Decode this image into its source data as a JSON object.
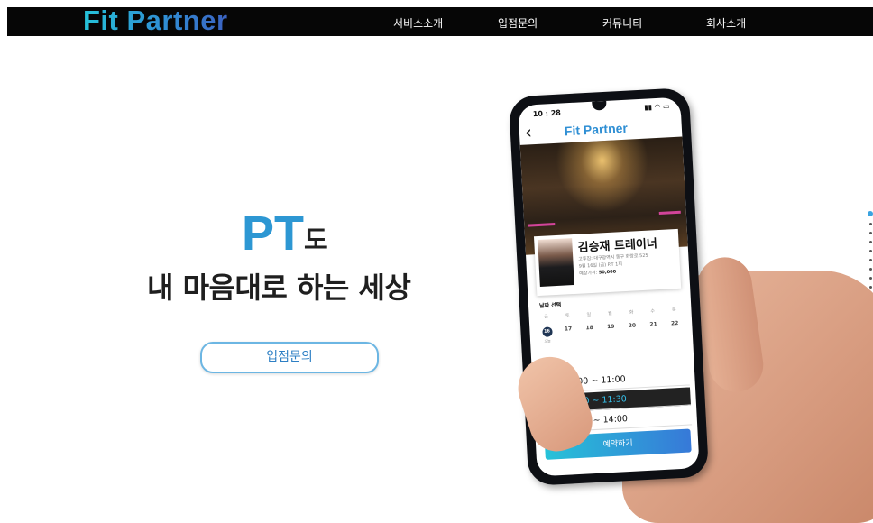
{
  "header": {
    "logo": "Fit Partner",
    "nav": [
      "서비스소개",
      "입점문의",
      "커뮤니티",
      "회사소개"
    ]
  },
  "hero": {
    "highlight": "PT",
    "suffix": "도",
    "headline": "내 마음대로 하는 세상",
    "cta_label": "입점문의"
  },
  "pagination": {
    "count": 9,
    "active_index": 0
  },
  "phone": {
    "status_time": "10 : 28",
    "status_icons": "▮▮ ◠ ▭",
    "back_icon": "‹",
    "app_logo": "Fit Partner",
    "trainer": {
      "name": "김승재 트레이너",
      "address": "고투짐: 대구광역시 동구 화랑로 525",
      "session": "9월 16일 (금) P.T 1회",
      "price_label": "예상가격:",
      "price": "50,000"
    },
    "date_section": {
      "title": "날짜 선택",
      "days": [
        "금",
        "토",
        "일",
        "월",
        "화",
        "수",
        "목"
      ],
      "dates": [
        "16",
        "17",
        "18",
        "19",
        "20",
        "21",
        "22"
      ],
      "selected_index": 0,
      "today_label": "오늘"
    },
    "slots": [
      "오전 10:00 ~ 11:00",
      "오전 10:30 ~ 11:30",
      "오후 13:00 ~ 14:00"
    ],
    "selected_slot": 1,
    "book_label": "예약하기"
  },
  "colors": {
    "navbar": "#060606",
    "accent": "#2d97d3",
    "cta_border": "#6cb6e3",
    "selected_slot_text": "#37c7f2"
  }
}
